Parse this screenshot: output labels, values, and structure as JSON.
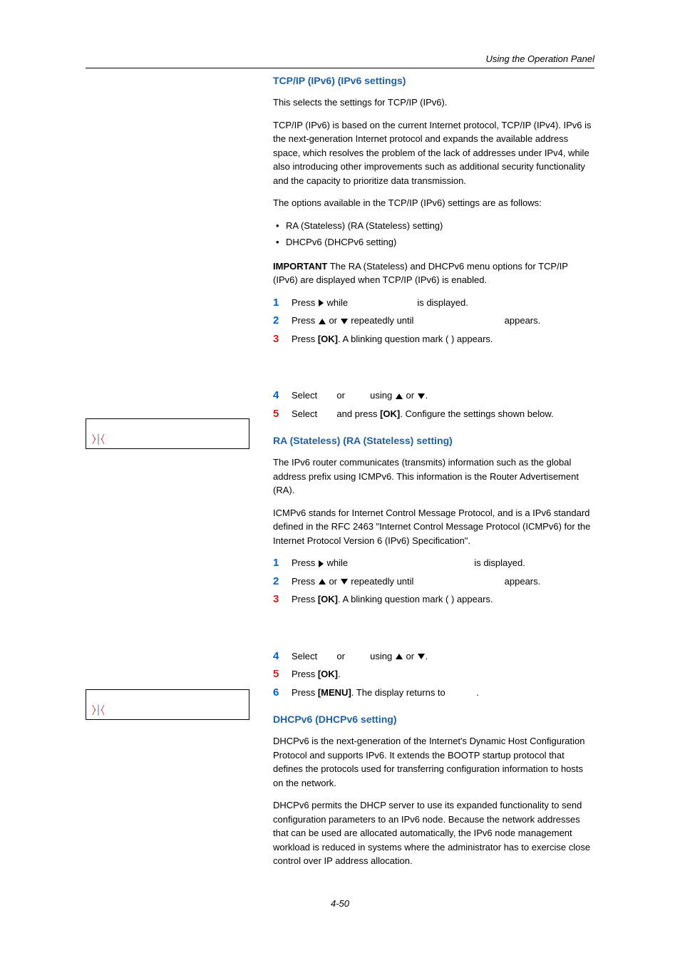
{
  "header": "Using the Operation Panel",
  "s1": {
    "title": "TCP/IP (IPv6) (IPv6 settings)",
    "p1": "This selects the settings for TCP/IP (IPv6).",
    "p2": "TCP/IP (IPv6) is based on the current Internet protocol, TCP/IP (IPv4). IPv6 is the next-generation Internet protocol and expands the available address space, which resolves the problem of the lack of addresses under IPv4, while also introducing other improvements such as additional security functionality and the capacity to prioritize data transmission.",
    "p3": "The options available in the TCP/IP (IPv6) settings are as follows:",
    "bullets": [
      "RA (Stateless) (RA (Stateless) setting)",
      "DHCPv6 (DHCPv6 setting)"
    ],
    "important_label": "IMPORTANT",
    "important_text": "  The RA (Stateless) and DHCPv6 menu options for TCP/IP (IPv6) are displayed when TCP/IP (IPv6) is enabled.",
    "step1a": "Press ",
    "step1b": " while ",
    "step1c": " is displayed.",
    "step2a": "Press ",
    "step2b": " or ",
    "step2c": " repeatedly until ",
    "step2d": " appears.",
    "step3a": "Press ",
    "step3b": "[OK]",
    "step3c": ". A blinking question mark ( ) appears.",
    "step4a": "Select ",
    "step4b": " or ",
    "step4c": " using ",
    "step4d": " or ",
    "step4e": ".",
    "step5a": "Select ",
    "step5b": " and press ",
    "step5c": "[OK]",
    "step5d": ". Configure the settings shown below."
  },
  "s2": {
    "title": "RA (Stateless) (RA (Stateless) setting)",
    "p1": "The IPv6 router communicates (transmits) information such as the global address prefix using ICMPv6. This information is the Router Advertisement (RA).",
    "p2": "ICMPv6 stands for Internet Control Message Protocol, and is a IPv6 standard defined in the RFC 2463 \"Internet Control Message Protocol (ICMPv6) for the Internet Protocol Version 6 (IPv6) Specification\".",
    "step1a": "Press ",
    "step1b": " while ",
    "step1c": " is displayed.",
    "step2a": "Press ",
    "step2b": " or ",
    "step2c": " repeatedly until ",
    "step2d": " appears.",
    "step3a": "Press ",
    "step3b": "[OK]",
    "step3c": ". A blinking question mark ( ) appears.",
    "step4a": "Select ",
    "step4b": " or ",
    "step4c": " using ",
    "step4d": " or ",
    "step4e": ".",
    "step5a": "Press ",
    "step5b": "[OK]",
    "step5c": ".",
    "step6a": "Press ",
    "step6b": "[MENU]",
    "step6c": ". The display returns to ",
    "step6d": "."
  },
  "s3": {
    "title": "DHCPv6 (DHCPv6 setting)",
    "p1": "DHCPv6 is the next-generation of the Internet's Dynamic Host Configuration Protocol and supports IPv6. It extends the BOOTP startup protocol that defines the protocols used for transferring configuration information to hosts on the network.",
    "p2": "DHCPv6 permits the DHCP server to use its expanded functionality to send configuration parameters to an IPv6 node. Because the network addresses that can be used are allocated automatically, the IPv6 node management workload is reduced in systems where the administrator has to exercise close control over IP address allocation."
  },
  "pagenum": "4-50"
}
